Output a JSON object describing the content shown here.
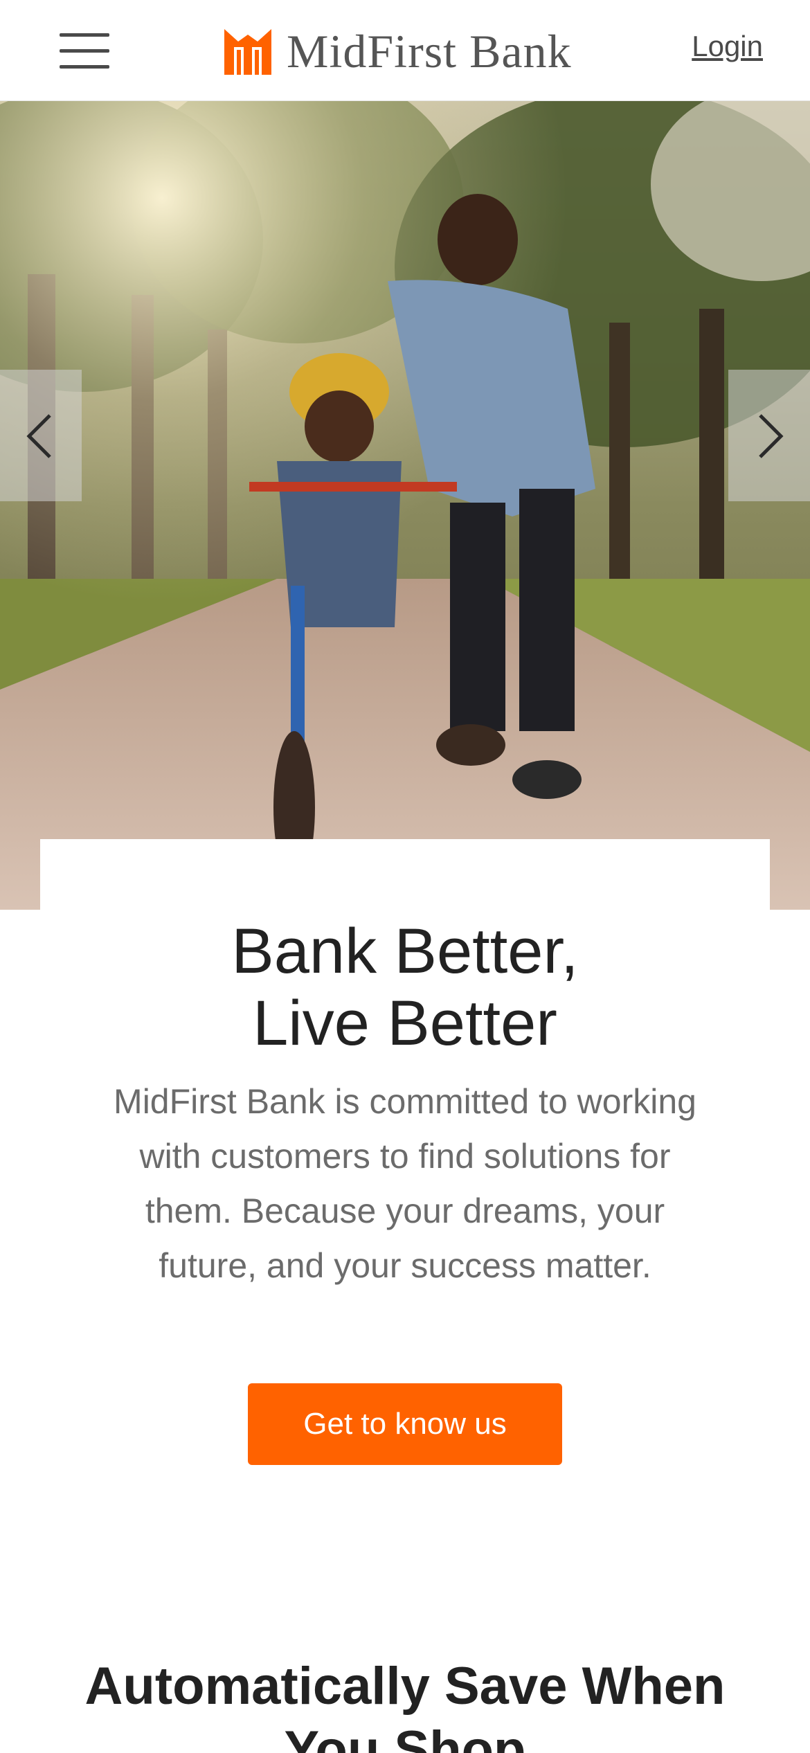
{
  "header": {
    "menu_icon": "hamburger-menu-icon",
    "logo_text": "MidFirst Bank",
    "logo_color": "#ff6200",
    "login_label": "Login"
  },
  "hero": {
    "image_alt": "Father teaching his son to ride a bike in a park",
    "prev_icon": "chevron-left-icon",
    "next_icon": "chevron-right-icon",
    "headline_line1": "Bank Better,",
    "headline_line2": "Live Better",
    "body": "MidFirst Bank is committed to working with customers to find solutions for them. Because your dreams, your future, and your success matter.",
    "cta_label": "Get to know us",
    "cta_color": "#ff6200"
  },
  "next_section": {
    "heading_line1": "Automatically Save When",
    "heading_line2": "You Shop"
  }
}
